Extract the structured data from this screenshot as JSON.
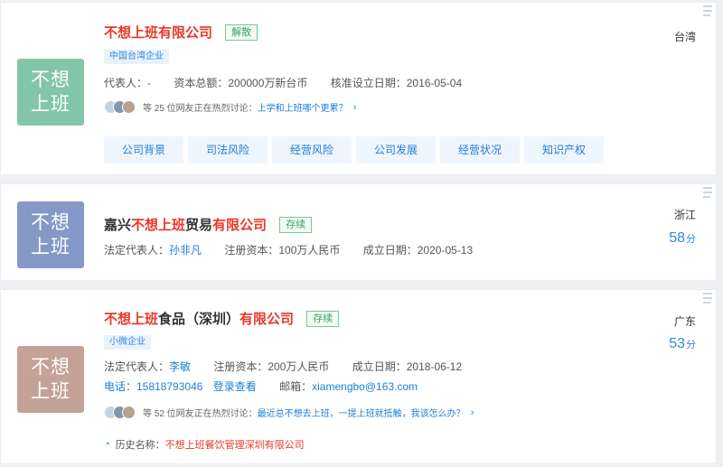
{
  "colors": {
    "logo1": "#82c6a7",
    "logo2": "#8598c7",
    "logo3": "#c5a297",
    "accent": "#1e7fd8",
    "red": "#e8392b"
  },
  "cards": [
    {
      "logo": [
        "不想",
        "上班"
      ],
      "title": "不想上班有限公司",
      "status": "解散",
      "tag": "中国台湾企业",
      "meta": {
        "rep": "代表人：-",
        "capital": "资本总额：200000万新台币",
        "date": "核准设立日期：2016-05-04"
      },
      "discussion": {
        "text": "等 25 位网友正在热烈讨论：",
        "topic": "上学和上班哪个更累？"
      },
      "tabs": [
        "公司背景",
        "司法风险",
        "经营风险",
        "公司发展",
        "经营状况",
        "知识产权"
      ],
      "region": "台湾"
    },
    {
      "logo": [
        "不想",
        "上班"
      ],
      "title_prefix": "嘉兴",
      "title_red": "不想上班",
      "title_mid": "贸易",
      "title_suffix": "有限公司",
      "status": "存续",
      "meta": {
        "rep_label": "法定代表人：",
        "rep": "孙非凡",
        "capital": "注册资本：100万人民币",
        "date": "成立日期：2020-05-13"
      },
      "region": "浙江",
      "score": "58",
      "score_unit": "分"
    },
    {
      "logo": [
        "不想",
        "上班"
      ],
      "title_red": "不想上班",
      "title_mid": "食品（深圳）",
      "title_suffix": "有限公司",
      "status": "存续",
      "tag": "小微企业",
      "meta": {
        "rep_label": "法定代表人：",
        "rep": "李敏",
        "capital": "注册资本：200万人民币",
        "date": "成立日期：2018-06-12"
      },
      "contact": {
        "phone": "电话：15818793046",
        "check": "登录查看",
        "email_label": "邮箱：",
        "email": "xiamengbo@163.com"
      },
      "discussion": {
        "text": "等 52 位网友正在热烈讨论：",
        "topic": "最近总不想去上班，一提上班就抵触，我该怎么办？"
      },
      "history": {
        "label": "历史名称：",
        "red": "不想上班",
        "rest": "餐饮管理深圳有限公司"
      },
      "region": "广东",
      "score": "53",
      "score_unit": "分"
    }
  ]
}
